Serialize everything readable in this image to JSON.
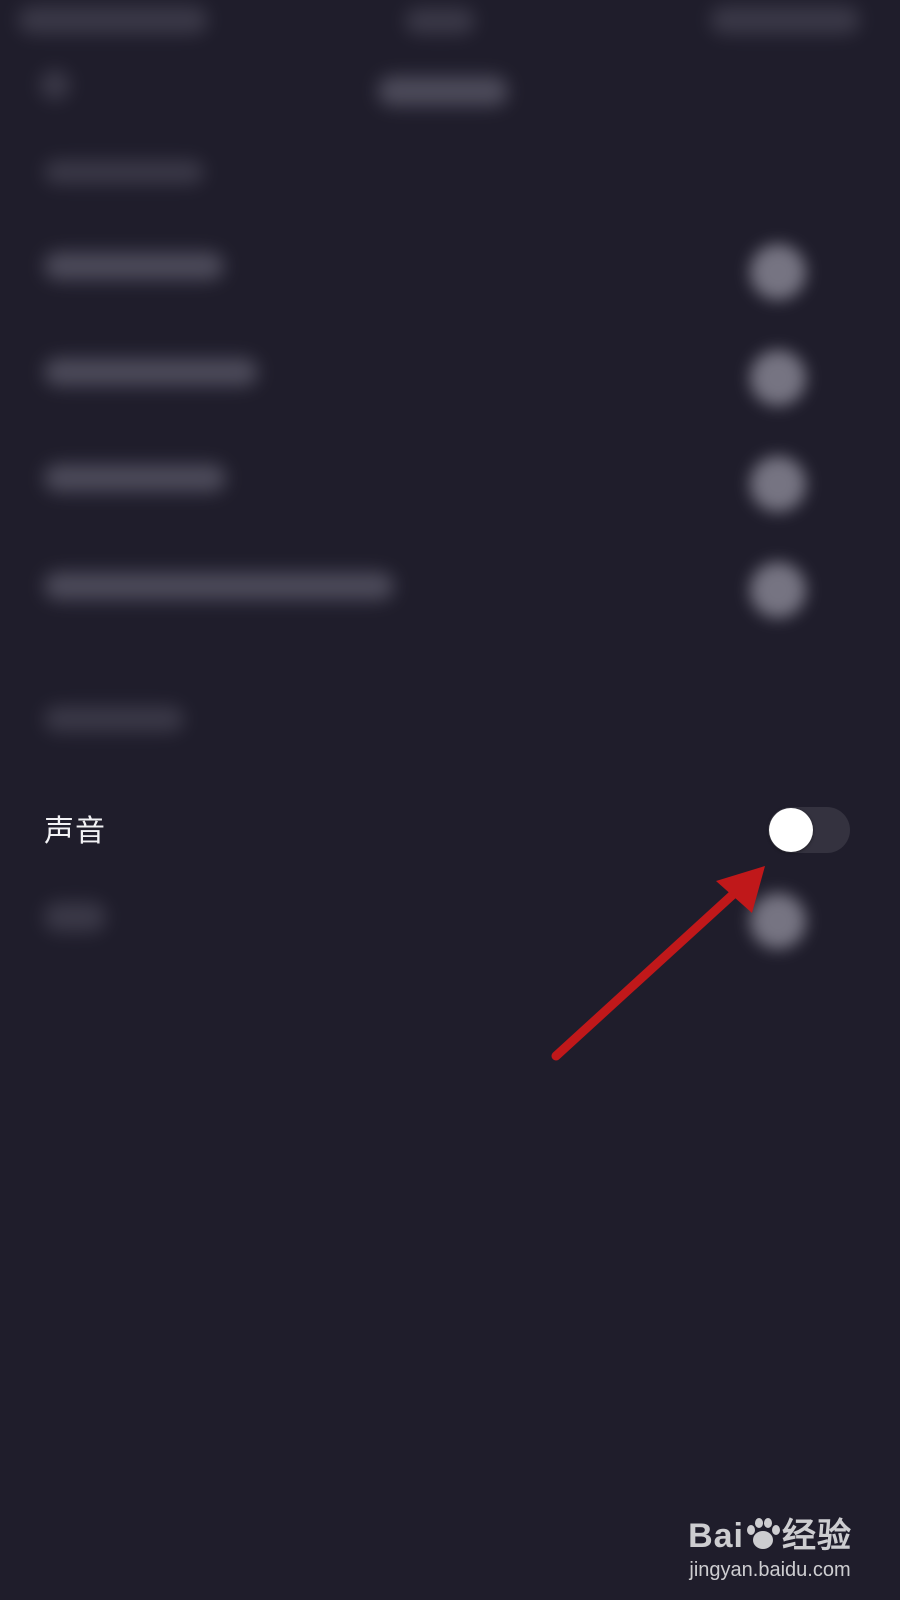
{
  "settings": {
    "sound_label": "声音",
    "sound_toggle_on": false
  },
  "colors": {
    "background": "#1f1d2b",
    "toggle_track": "#34323f",
    "toggle_knob": "#ffffff",
    "arrow": "#c0181a"
  },
  "watermark": {
    "brand_left": "Bai",
    "brand_right": "经验",
    "url": "jingyan.baidu.com"
  }
}
